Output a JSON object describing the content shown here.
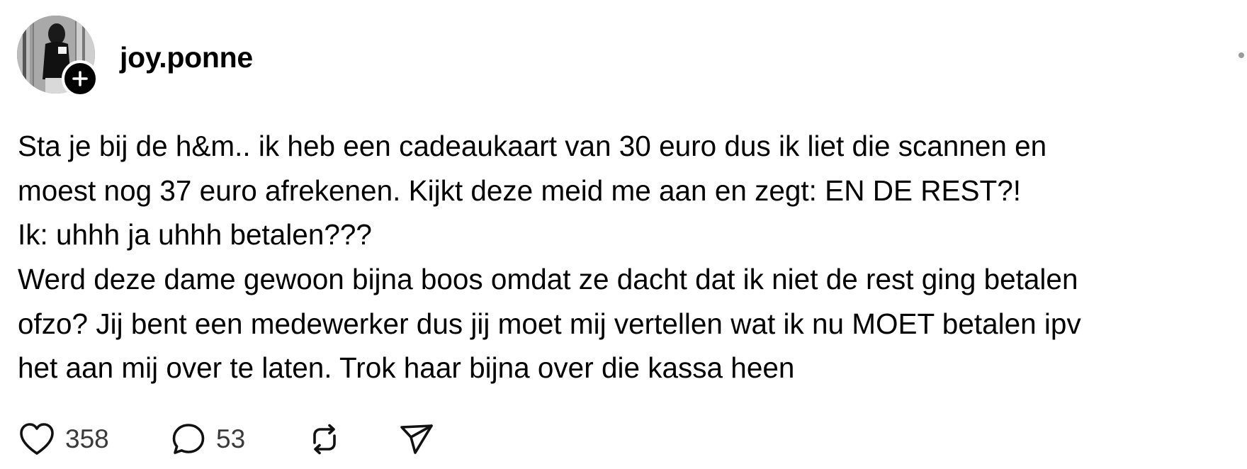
{
  "post": {
    "author": {
      "username": "joy.ponne",
      "avatar_icon": "profile-photo",
      "follow_icon": "plus-icon"
    },
    "text_lines": [
      "Sta je bij de h&m.. ik heb een cadeaukaart van 30 euro dus ik liet die scannen en",
      "moest nog 37 euro afrekenen. Kijkt deze meid me aan en zegt: EN DE REST?!",
      "Ik: uhhh ja uhhh betalen???",
      "Werd deze dame gewoon bijna boos omdat ze dacht dat ik niet de rest ging betalen",
      "ofzo? Jij bent een medewerker dus jij moet mij vertellen wat ik nu MOET betalen ipv",
      "het aan mij over te laten. Trok haar bijna over die kassa heen"
    ],
    "actions": {
      "like_icon": "heart-icon",
      "like_count": "358",
      "reply_icon": "speech-bubble-icon",
      "reply_count": "53",
      "repost_icon": "repost-icon",
      "share_icon": "paper-plane-icon"
    }
  },
  "colors": {
    "text": "#000000",
    "count_text": "#3a3a3a",
    "background": "#ffffff",
    "more_dot": "#9a9a9a"
  }
}
